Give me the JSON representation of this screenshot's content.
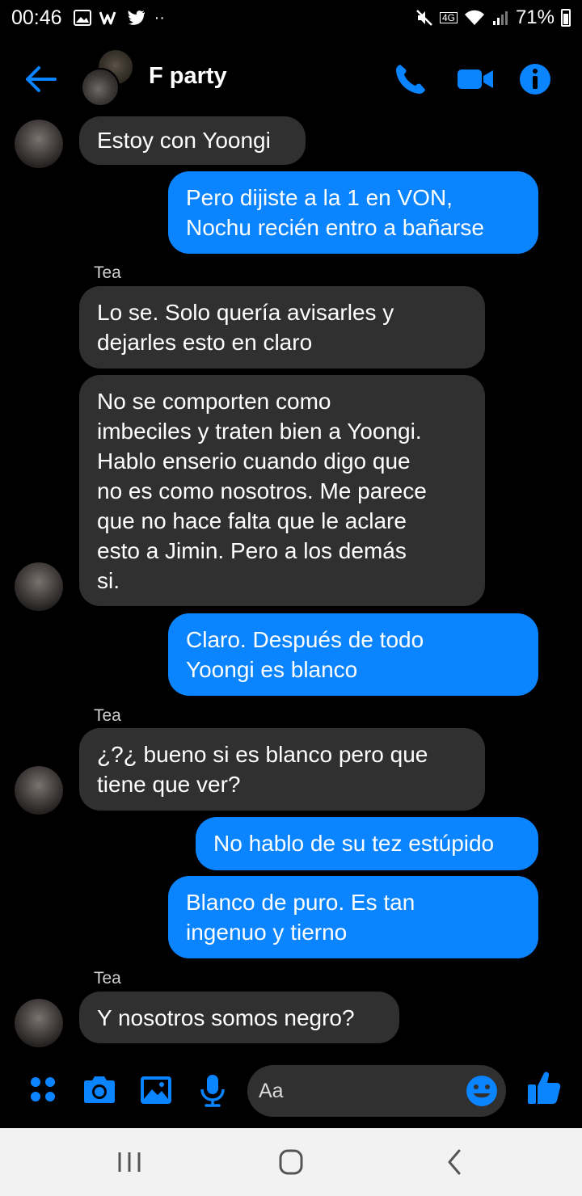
{
  "status_bar": {
    "time": "00:46",
    "battery": "71%",
    "network": "4G"
  },
  "header": {
    "title": "F party"
  },
  "messages": [
    {
      "side": "in",
      "text": "Estoy con Yoongi"
    },
    {
      "side": "out",
      "text": "Pero dijiste a la 1 en VON,\nNochu recién entro a bañarse"
    },
    {
      "side": "in",
      "sender": "Tea",
      "text": "Lo se. Solo quería avisarles y\ndejarles esto en claro"
    },
    {
      "side": "in",
      "text": "No se comporten como\nimbeciles y traten bien a Yoongi.\nHablo enserio cuando digo que\nno es como nosotros. Me parece\nque no hace falta que le aclare\nesto a Jimin. Pero a los demás\nsi."
    },
    {
      "side": "out",
      "text": "Claro. Después de todo\nYoongi es blanco"
    },
    {
      "side": "in",
      "sender": "Tea",
      "text": "¿?¿ bueno si es blanco pero que\ntiene que ver?"
    },
    {
      "side": "out",
      "text": "No hablo de su tez estúpido"
    },
    {
      "side": "out",
      "text": "Blanco de puro.  Es tan\ningenuo y tierno"
    },
    {
      "side": "in",
      "sender": "Tea",
      "text": "Y nosotros somos negro?"
    }
  ],
  "composer": {
    "placeholder": "Aa"
  },
  "colors": {
    "accent": "#0a84ff",
    "incoming_bubble": "#303030",
    "background": "#000000",
    "navbar": "#f2f2f2"
  },
  "icons": {
    "header": [
      "back-arrow-icon",
      "phone-icon",
      "video-icon",
      "info-icon"
    ],
    "composer": [
      "apps-icon",
      "camera-icon",
      "gallery-icon",
      "mic-icon",
      "emoji-icon",
      "like-icon"
    ],
    "nav": [
      "recents-icon",
      "home-icon",
      "back-icon"
    ]
  }
}
